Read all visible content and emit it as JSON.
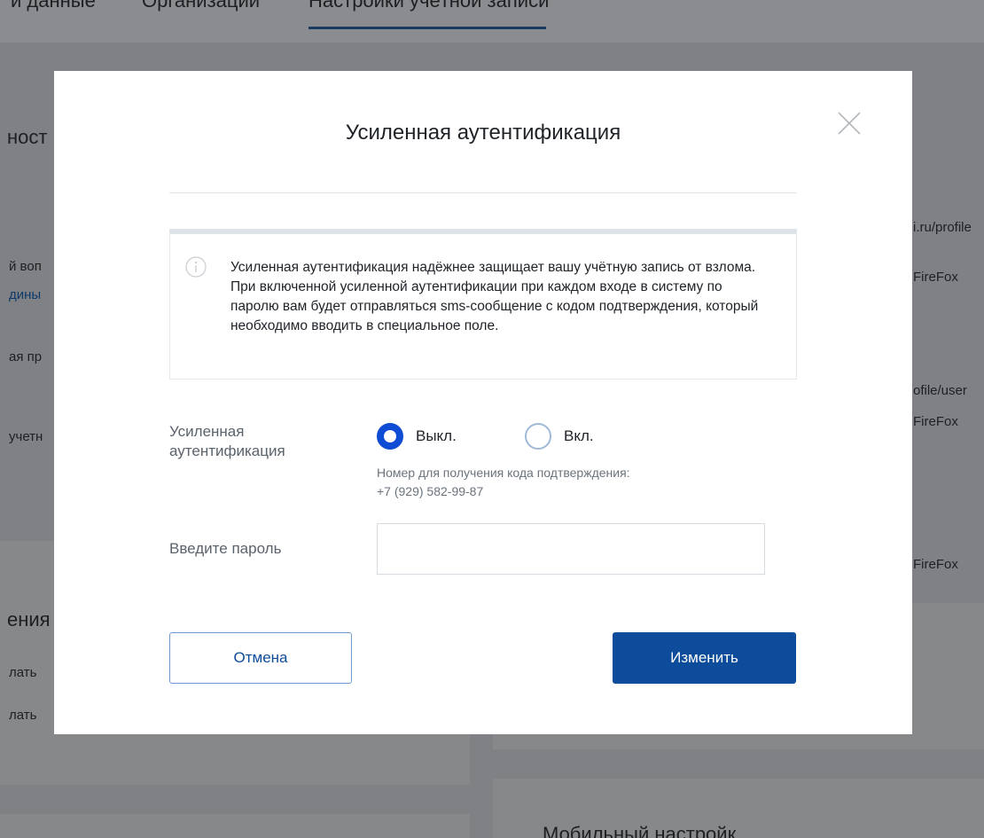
{
  "background": {
    "tabs": [
      "и данные",
      "Организации",
      "Настройки учётной записи"
    ],
    "left_fragments": [
      "ност",
      "й воп",
      "дины",
      "ая пр",
      "учетн",
      "ения",
      "лать",
      "лать"
    ],
    "right_fragments": [
      "i.ru/profile",
      "FireFox",
      "ofile/user",
      "FireFox",
      "FireFox",
      "Мобильный настройк"
    ]
  },
  "modal": {
    "title": "Усиленная аутентификация",
    "info_text": "Усиленная аутентификация надёжнее защищает вашу учётную запись от взлома. При включенной усиленной аутентификации при каждом входе в систему по паролю вам будет отправляться sms-сообщение с кодом подтверждения, который необходимо вводить в специальное поле.",
    "auth_label": "Усиленная аутентификация",
    "options": {
      "off_label": "Выкл.",
      "on_label": "Вкл.",
      "selected": "off"
    },
    "hint_line1": "Номер для получения кода подтверждения:",
    "hint_line2": "+7 (929) 582-99-87",
    "password_label": "Введите пароль",
    "password_value": "",
    "cancel_label": "Отмена",
    "submit_label": "Изменить"
  },
  "colors": {
    "accent": "#0d4c9a",
    "radio_selected": "#0d4cd3",
    "overlay": "#7f8184"
  },
  "icons": {
    "close": "close-icon",
    "info": "info-icon"
  }
}
